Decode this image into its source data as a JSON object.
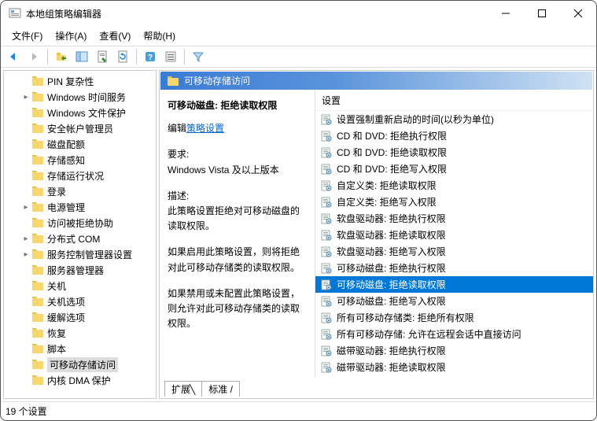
{
  "window": {
    "title": "本地组策略编辑器"
  },
  "menu": {
    "file": "文件(F)",
    "action": "操作(A)",
    "view": "查看(V)",
    "help": "帮助(H)"
  },
  "tree": {
    "items": [
      {
        "label": "PIN 复杂性",
        "exp": ""
      },
      {
        "label": "Windows 时间服务",
        "exp": "▸"
      },
      {
        "label": "Windows 文件保护",
        "exp": ""
      },
      {
        "label": "安全帐户管理员",
        "exp": ""
      },
      {
        "label": "磁盘配额",
        "exp": ""
      },
      {
        "label": "存储感知",
        "exp": ""
      },
      {
        "label": "存储运行状况",
        "exp": ""
      },
      {
        "label": "登录",
        "exp": ""
      },
      {
        "label": "电源管理",
        "exp": "▸"
      },
      {
        "label": "访问被拒绝协助",
        "exp": ""
      },
      {
        "label": "分布式 COM",
        "exp": "▸"
      },
      {
        "label": "服务控制管理器设置",
        "exp": "▸"
      },
      {
        "label": "服务器管理器",
        "exp": ""
      },
      {
        "label": "关机",
        "exp": ""
      },
      {
        "label": "关机选项",
        "exp": ""
      },
      {
        "label": "缓解选项",
        "exp": ""
      },
      {
        "label": "恢复",
        "exp": ""
      },
      {
        "label": "脚本",
        "exp": ""
      },
      {
        "label": "可移动存储访问",
        "exp": "",
        "selected": true
      },
      {
        "label": "内核 DMA 保护",
        "exp": ""
      }
    ]
  },
  "pane": {
    "header": "可移动存储访问",
    "desc": {
      "title": "可移动磁盘: 拒绝读取权限",
      "editprefix": "编辑",
      "editlink": "策略设置",
      "reqlabel": "要求:",
      "req": "Windows Vista 及以上版本",
      "desclabel": "描述:",
      "desc1": "此策略设置拒绝对可移动磁盘的读取权限。",
      "desc2": "如果启用此策略设置，则将拒绝对此可移动存储类的读取权限。",
      "desc3": "如果禁用或未配置此策略设置，则允许对此可移动存储类的读取权限。"
    },
    "listheader": "设置",
    "items": [
      {
        "label": "设置强制重新启动的时间(以秒为单位)"
      },
      {
        "label": "CD 和 DVD: 拒绝执行权限"
      },
      {
        "label": "CD 和 DVD: 拒绝读取权限"
      },
      {
        "label": "CD 和 DVD: 拒绝写入权限"
      },
      {
        "label": "自定义类: 拒绝读取权限"
      },
      {
        "label": "自定义类: 拒绝写入权限"
      },
      {
        "label": "软盘驱动器: 拒绝执行权限"
      },
      {
        "label": "软盘驱动器: 拒绝读取权限"
      },
      {
        "label": "软盘驱动器: 拒绝写入权限"
      },
      {
        "label": "可移动磁盘: 拒绝执行权限"
      },
      {
        "label": "可移动磁盘: 拒绝读取权限",
        "selected": true
      },
      {
        "label": "可移动磁盘: 拒绝写入权限"
      },
      {
        "label": "所有可移动存储类: 拒绝所有权限"
      },
      {
        "label": "所有可移动存储: 允许在远程会话中直接访问"
      },
      {
        "label": "磁带驱动器: 拒绝执行权限"
      },
      {
        "label": "磁带驱动器: 拒绝读取权限"
      }
    ],
    "tabs": {
      "ext": "扩展",
      "std": "标准"
    }
  },
  "status": "19 个设置"
}
